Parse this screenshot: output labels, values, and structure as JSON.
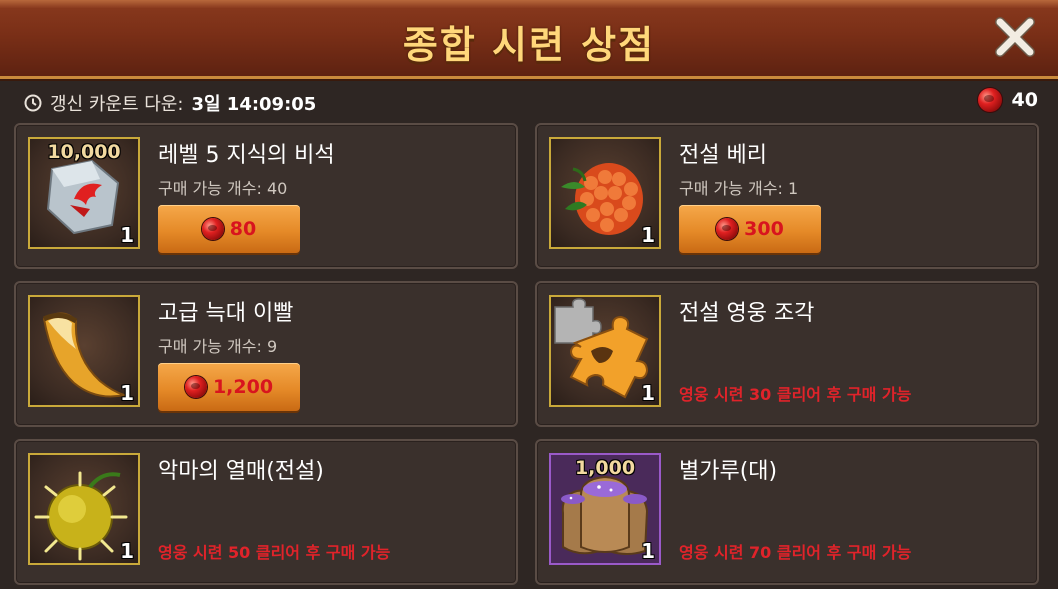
{
  "header": {
    "title": "종합 시련 상점"
  },
  "topbar": {
    "refresh_label": "갱신 카운트 다운:",
    "refresh_time": "3일 14:09:05",
    "currency_amount": "40"
  },
  "items": [
    {
      "name": "레벨 5 지식의 비석",
      "limit": "구매 가능 개수: 40",
      "price": "80",
      "quantity": "1",
      "amount_label": "10,000",
      "icon": "knowledge-stone-icon"
    },
    {
      "name": "전설 베리",
      "limit": "구매 가능 개수: 1",
      "price": "300",
      "quantity": "1",
      "icon": "legendary-berry-icon"
    },
    {
      "name": "고급 늑대 이빨",
      "limit": "구매 가능 개수: 9",
      "price": "1,200",
      "quantity": "1",
      "icon": "wolf-fang-icon"
    },
    {
      "name": "전설 영웅 조각",
      "requirement": "영웅 시련 30 클리어 후 구매 가능",
      "quantity": "1",
      "icon": "hero-fragment-icon"
    },
    {
      "name": "악마의 열매(전설)",
      "requirement": "영웅 시련 50 클리어 후 구매 가능",
      "quantity": "1",
      "icon": "devil-fruit-icon"
    },
    {
      "name": "별가루(대)",
      "requirement": "영웅 시련 70 클리어 후 구매 가능",
      "quantity": "1",
      "amount_label": "1,000",
      "icon": "stardust-sack-icon"
    }
  ],
  "colors": {
    "accent_gold": "#ffd77a",
    "price_red": "#d8141e",
    "requirement_red": "#e0232a"
  }
}
